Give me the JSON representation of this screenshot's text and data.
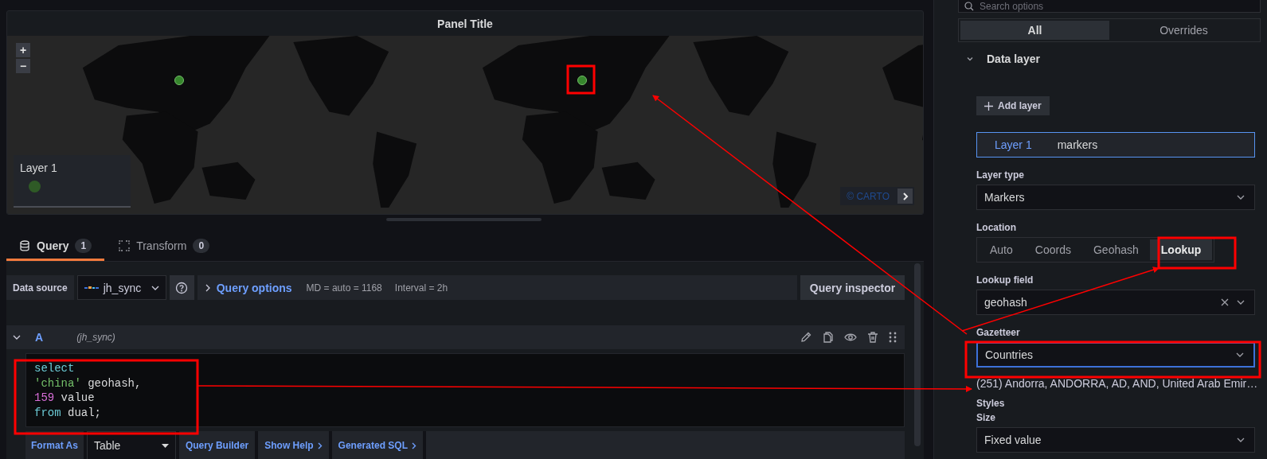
{
  "panel": {
    "title": "Panel Title",
    "zoom": [
      "+",
      "−"
    ],
    "legend": {
      "title": "Layer 1"
    },
    "attribution": "© CARTO"
  },
  "editor_tabs": [
    {
      "label": "Query",
      "count": "1",
      "selected": true
    },
    {
      "label": "Transform",
      "count": "0",
      "selected": false
    }
  ],
  "query_bar": {
    "data_source_label": "Data source",
    "data_source": "jh_sync",
    "query_options": "Query options",
    "md": "MD = auto = 1168",
    "interval": "Interval = 2h",
    "inspector": "Query inspector"
  },
  "query": {
    "ref": "A",
    "source": "(jh_sync)",
    "expanded": true,
    "code": [
      [
        {
          "text": "select",
          "kind": "keyword"
        }
      ],
      [
        {
          "text": "'china'",
          "kind": "string"
        },
        {
          "text": " geohash,",
          "kind": "plain"
        }
      ],
      [
        {
          "text": "159",
          "kind": "number"
        },
        {
          "text": " value",
          "kind": "plain"
        }
      ],
      [
        {
          "text": "from",
          "kind": "keyword"
        },
        {
          "text": " dual;",
          "kind": "plain"
        }
      ]
    ]
  },
  "query_footer": {
    "format_label": "Format As",
    "format": "Table",
    "buttons": [
      "Query Builder",
      "Show Help",
      "Generated SQL"
    ]
  },
  "options": {
    "search_placeholder": "Search options",
    "tabs": [
      {
        "label": "All",
        "selected": true
      },
      {
        "label": "Overrides",
        "selected": false
      }
    ],
    "section": {
      "title": "Data layer",
      "expanded": true
    },
    "add_layer": "Add layer",
    "layer": {
      "name": "Layer 1",
      "type": "markers"
    },
    "fields": [
      {
        "kind": "select",
        "label": "Layer type",
        "value": "Markers",
        "clearable": false,
        "focused": false
      },
      {
        "kind": "radio",
        "label": "Location",
        "options": [
          {
            "label": "Auto",
            "selected": false
          },
          {
            "label": "Coords",
            "selected": false
          },
          {
            "label": "Geohash",
            "selected": false
          },
          {
            "label": "Lookup",
            "selected": true
          }
        ]
      },
      {
        "kind": "select",
        "label": "Lookup field",
        "value": "geohash",
        "clearable": true,
        "focused": false
      },
      {
        "kind": "select",
        "label": "Gazetteer",
        "value": "Countries",
        "clearable": false,
        "focused": true,
        "description": "(251) Andorra, ANDORRA, AD, AND, United Arab Emir…"
      },
      {
        "kind": "heading",
        "label": "Styles"
      },
      {
        "kind": "select",
        "label": "Size",
        "value": "Fixed value",
        "clearable": false,
        "focused": false
      }
    ]
  }
}
